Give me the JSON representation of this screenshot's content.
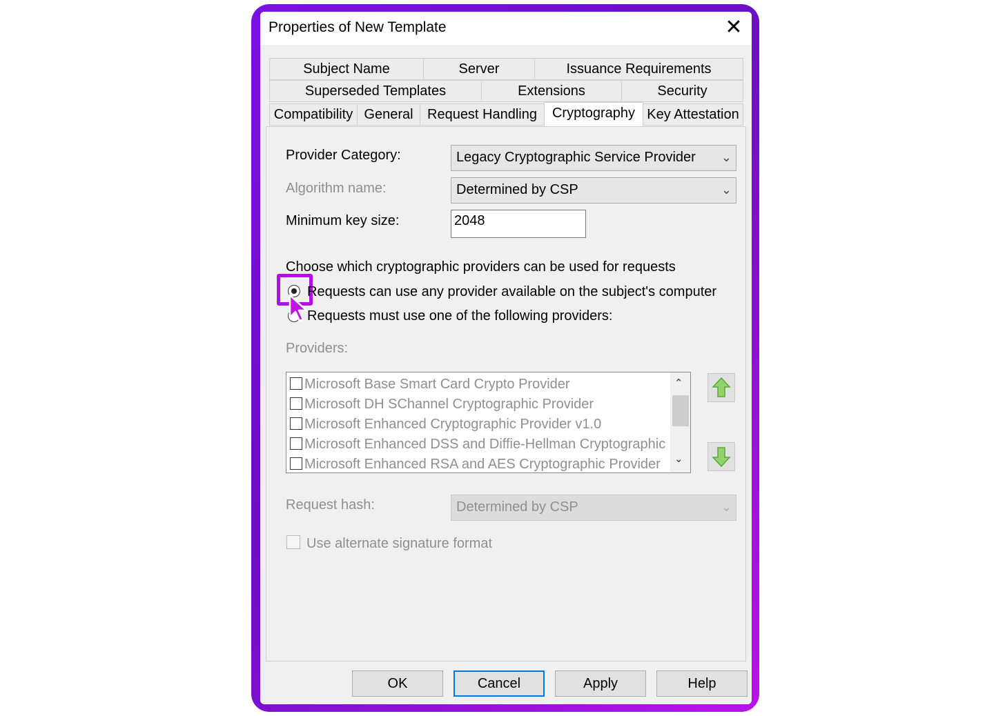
{
  "window": {
    "title": "Properties of New Template",
    "close_symbol": "✕"
  },
  "tabs": {
    "row1": [
      "Subject Name",
      "Server",
      "Issuance Requirements"
    ],
    "row2": [
      "Superseded Templates",
      "Extensions",
      "Security"
    ],
    "row3": [
      "Compatibility",
      "General",
      "Request Handling",
      "Cryptography",
      "Key Attestation"
    ],
    "active": "Cryptography"
  },
  "form": {
    "provider_category_label": "Provider Category:",
    "provider_category_value": "Legacy Cryptographic Service Provider",
    "algorithm_label": "Algorithm name:",
    "algorithm_value": "Determined by CSP",
    "min_key_label": "Minimum key size:",
    "min_key_value": "2048",
    "choose_text": "Choose which cryptographic providers can be used for requests",
    "radio_any_label": "Requests can use any provider available on the subject's computer",
    "radio_any_selected": true,
    "radio_specific_label": "Requests must use one of the following providers:",
    "providers_label": "Providers:",
    "providers": [
      "Microsoft Base Smart Card Crypto Provider",
      "Microsoft DH SChannel Cryptographic Provider",
      "Microsoft Enhanced Cryptographic Provider v1.0",
      "Microsoft Enhanced DSS and Diffie-Hellman Cryptographic Pr",
      "Microsoft Enhanced RSA and AES Cryptographic Provider"
    ],
    "request_hash_label": "Request hash:",
    "request_hash_value": "Determined by CSP",
    "alt_signature_label": "Use alternate signature format"
  },
  "buttons": {
    "ok": "OK",
    "cancel": "Cancel",
    "apply": "Apply",
    "help": "Help"
  },
  "colors": {
    "highlight": "#b010e6",
    "frame_start": "#7a10e0",
    "frame_end": "#b812ea",
    "arrow_green": "#6cc24a"
  },
  "icons": [
    "close-icon",
    "chevron-down-icon",
    "arrow-up-icon",
    "arrow-down-icon",
    "cursor-icon"
  ]
}
